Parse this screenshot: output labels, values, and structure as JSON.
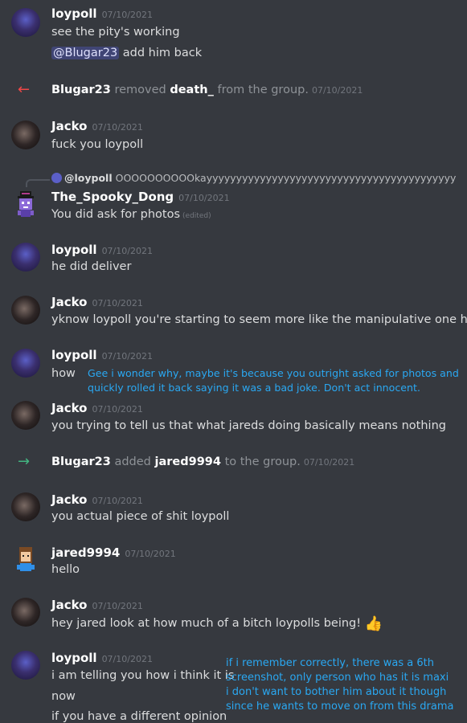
{
  "colors": {
    "background": "#36393f",
    "text": "#dcddde",
    "muted": "#72767d",
    "annotation": "#2aa8f2",
    "remove_arrow": "#f04747",
    "add_arrow": "#43b581"
  },
  "messages": [
    {
      "user": "loypoll",
      "time": "07/10/2021",
      "lines": [
        "see the pity's working"
      ],
      "mention": "@Blugar23",
      "mention_text": "add him back"
    },
    {
      "system": "Blugar23",
      "verb": "removed",
      "target": "death_",
      "suffix": "from the group.",
      "time": "07/10/2021"
    },
    {
      "user": "Jacko",
      "time": "07/10/2021",
      "lines": [
        "fuck you loypoll"
      ]
    },
    {
      "reply_to": "@loypoll",
      "reply_text": "OOOOOOOOOOkayyyyyyyyyyyyyyyyyyyyyyyyyyyyyyyyyyyyyyyyyy"
    },
    {
      "user": "The_Spooky_Dong",
      "time": "07/10/2021",
      "lines": [
        "You did ask for photos"
      ],
      "edited": "(edited)"
    },
    {
      "user": "loypoll",
      "time": "07/10/2021",
      "lines": [
        "he did deliver"
      ]
    },
    {
      "user": "Jacko",
      "time": "07/10/2021",
      "lines": [
        "yknow loypoll you're starting to seem more like the manipulative one here"
      ]
    },
    {
      "user": "loypoll",
      "time": "07/10/2021",
      "lines": [
        "how"
      ]
    },
    {
      "user": "Jacko",
      "time": "07/10/2021",
      "lines": [
        "you trying to tell us that what jareds doing basically means nothing"
      ]
    },
    {
      "system": "Blugar23",
      "verb": "added",
      "target": "jared9994",
      "suffix": "to the group.",
      "time": "07/10/2021"
    },
    {
      "user": "Jacko",
      "time": "07/10/2021",
      "lines": [
        "you actual piece of shit loypoll"
      ]
    },
    {
      "user": "jared9994",
      "time": "07/10/2021",
      "lines": [
        "hello"
      ]
    },
    {
      "user": "Jacko",
      "time": "07/10/2021",
      "lines": [
        "hey jared look at how much of a bitch loypolls being!"
      ]
    },
    {
      "user": "loypoll",
      "time": "07/10/2021",
      "lines": [
        "i am telling you how i think it is",
        "now",
        "if you have a different opinion"
      ]
    }
  ],
  "annotations": [
    {
      "lines": [
        "Gee i wonder why, maybe it's because you outright asked for photos and",
        "quickly rolled it back saying it was a bad joke. Don't act innocent."
      ]
    },
    {
      "lines": [
        "if i remember correctly, there was a 6th",
        "screenshot, only person who has it is maxi",
        "i don't want to bother him about it though",
        "since he wants to move on from this drama"
      ]
    }
  ]
}
